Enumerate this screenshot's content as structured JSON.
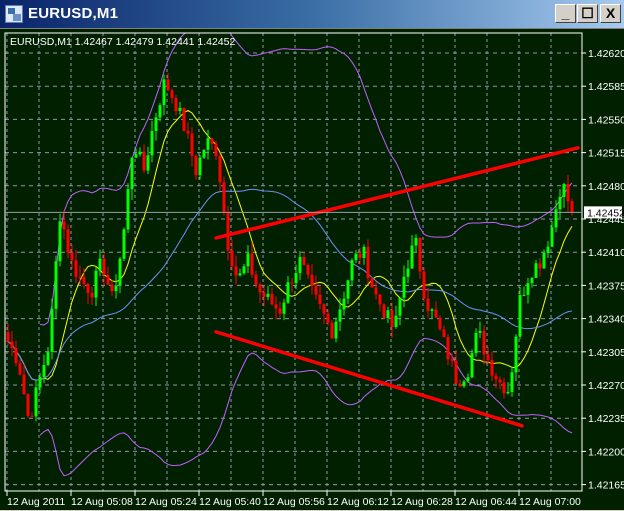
{
  "window": {
    "title": "EURUSD,M1",
    "minimize": "_",
    "maximize": "☐",
    "close": "X"
  },
  "chart_info": {
    "text": "EURUSD,M1  1.42467 1.42479 1.42441 1.42452"
  },
  "current_price": "1.42452",
  "colors": {
    "background": "#002000",
    "bull": "#00ff00",
    "bear": "#ff0000",
    "grid": "#8a9aa8",
    "ma_fast": "#ffff00",
    "ma_slow": "#6f8fff",
    "band": "#c060ff",
    "trendline": "#ff0000"
  },
  "chart_data": {
    "type": "candlestick",
    "symbol": "EURUSD",
    "timeframe": "M1",
    "ylim": [
      1.4215,
      1.4264
    ],
    "y_ticks": [
      "1.42165",
      "1.42200",
      "1.42235",
      "1.42270",
      "1.42305",
      "1.42340",
      "1.42375",
      "1.42410",
      "1.42445",
      "1.42480",
      "1.42515",
      "1.42550",
      "1.42585",
      "1.42620"
    ],
    "x_ticks": [
      "12 Aug 2011",
      "12 Aug 05:08",
      "12 Aug 05:24",
      "12 Aug 05:40",
      "12 Aug 05:56",
      "12 Aug 06:12",
      "12 Aug 06:28",
      "12 Aug 06:44",
      "12 Aug 07:00"
    ],
    "candle_count": 142,
    "approx_closes": [
      1.42316,
      1.42295,
      1.42232,
      1.42274,
      1.42316,
      1.42453,
      1.42401,
      1.4238,
      1.42369,
      1.42401,
      1.42359,
      1.42422,
      1.42527,
      1.42496,
      1.42548,
      1.4259,
      1.42569,
      1.42538,
      1.42496,
      1.42527,
      1.42517,
      1.42422,
      1.4238,
      1.42401,
      1.42369,
      1.42359,
      1.42348,
      1.4238,
      1.42401,
      1.42369,
      1.42348,
      1.42327,
      1.42359,
      1.42401,
      1.42411,
      1.42369,
      1.42348,
      1.42327,
      1.4239,
      1.42422,
      1.42359,
      1.42337,
      1.42306,
      1.42274,
      1.42285,
      1.42327,
      1.42295,
      1.42274,
      1.42264,
      1.42359,
      1.4239,
      1.42401,
      1.42432,
      1.42485,
      1.42452
    ],
    "trendlines": [
      {
        "name": "upper",
        "from": {
          "bar": 52,
          "price": 1.42425
        },
        "to": {
          "bar": 142.5,
          "price": 1.4252
        }
      },
      {
        "name": "lower",
        "from": {
          "bar": 52,
          "price": 1.42326
        },
        "to": {
          "bar": 128.5,
          "price": 1.42227
        }
      }
    ],
    "indicators": [
      "MA fast (yellow)",
      "MA slow (blue)",
      "Bands (purple)"
    ]
  }
}
